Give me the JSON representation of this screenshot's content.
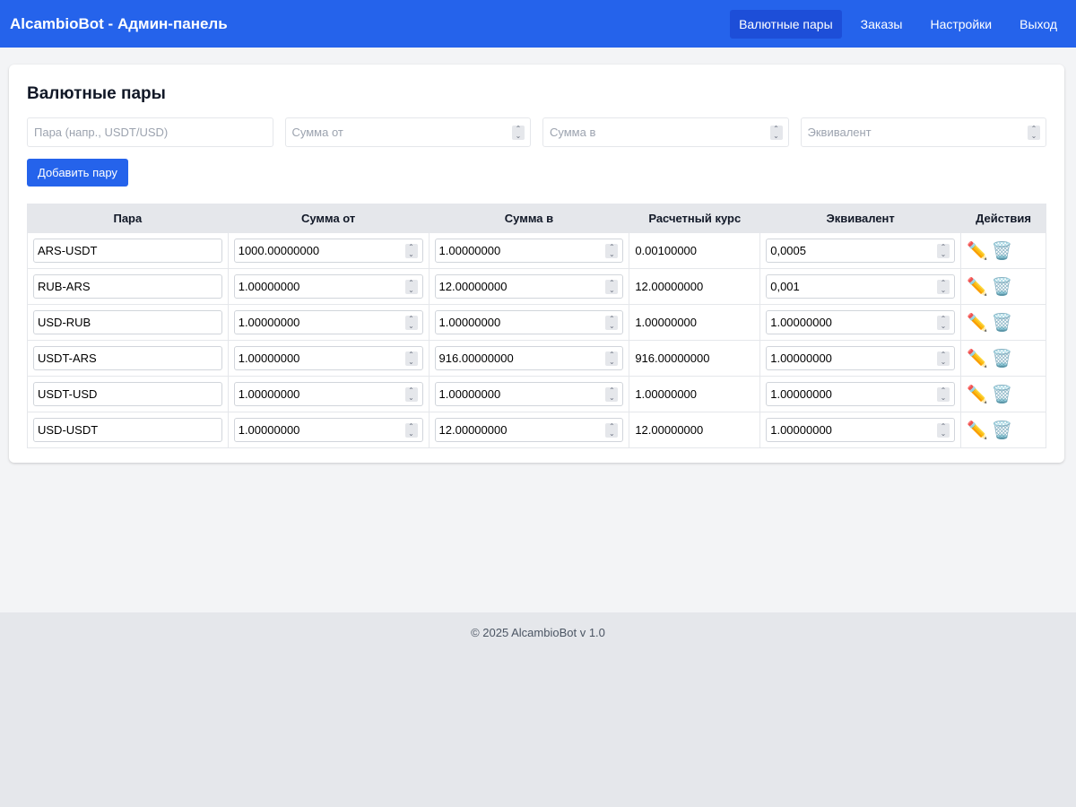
{
  "header": {
    "brand": "AlcambioBot - Админ-панель",
    "nav": [
      {
        "label": "Валютные пары",
        "active": true
      },
      {
        "label": "Заказы",
        "active": false
      },
      {
        "label": "Настройки",
        "active": false
      },
      {
        "label": "Выход",
        "active": false
      }
    ]
  },
  "main": {
    "title": "Валютные пары",
    "form": {
      "pair_placeholder": "Пара (напр., USDT/USD)",
      "amount_from_placeholder": "Сумма от",
      "amount_to_placeholder": "Сумма в",
      "equivalent_placeholder": "Эквивалент",
      "add_button": "Добавить пару"
    },
    "table": {
      "columns": [
        "Пара",
        "Сумма от",
        "Сумма в",
        "Расчетный курс",
        "Эквивалент",
        "Действия"
      ],
      "rows": [
        {
          "pair": "ARS-USDT",
          "from": "1000.00000000",
          "to": "1.00000000",
          "rate": "0.00100000",
          "equiv": "0,0005"
        },
        {
          "pair": "RUB-ARS",
          "from": "1.00000000",
          "to": "12.00000000",
          "rate": "12.00000000",
          "equiv": "0,001"
        },
        {
          "pair": "USD-RUB",
          "from": "1.00000000",
          "to": "1.00000000",
          "rate": "1.00000000",
          "equiv": "1.00000000"
        },
        {
          "pair": "USDT-ARS",
          "from": "1.00000000",
          "to": "916.00000000",
          "rate": "916.00000000",
          "equiv": "1.00000000"
        },
        {
          "pair": "USDT-USD",
          "from": "1.00000000",
          "to": "1.00000000",
          "rate": "1.00000000",
          "equiv": "1.00000000"
        },
        {
          "pair": "USD-USDT",
          "from": "1.00000000",
          "to": "12.00000000",
          "rate": "12.00000000",
          "equiv": "1.00000000"
        }
      ],
      "edit_icon": "✏️",
      "delete_icon": "🗑️"
    }
  },
  "footer": {
    "text": "© 2025 AlcambioBot v 1.0"
  },
  "colors": {
    "accent": "#2563eb",
    "accent_active": "#1d4ed8",
    "background": "#f3f4f6",
    "footer_bg": "#e5e7eb"
  }
}
